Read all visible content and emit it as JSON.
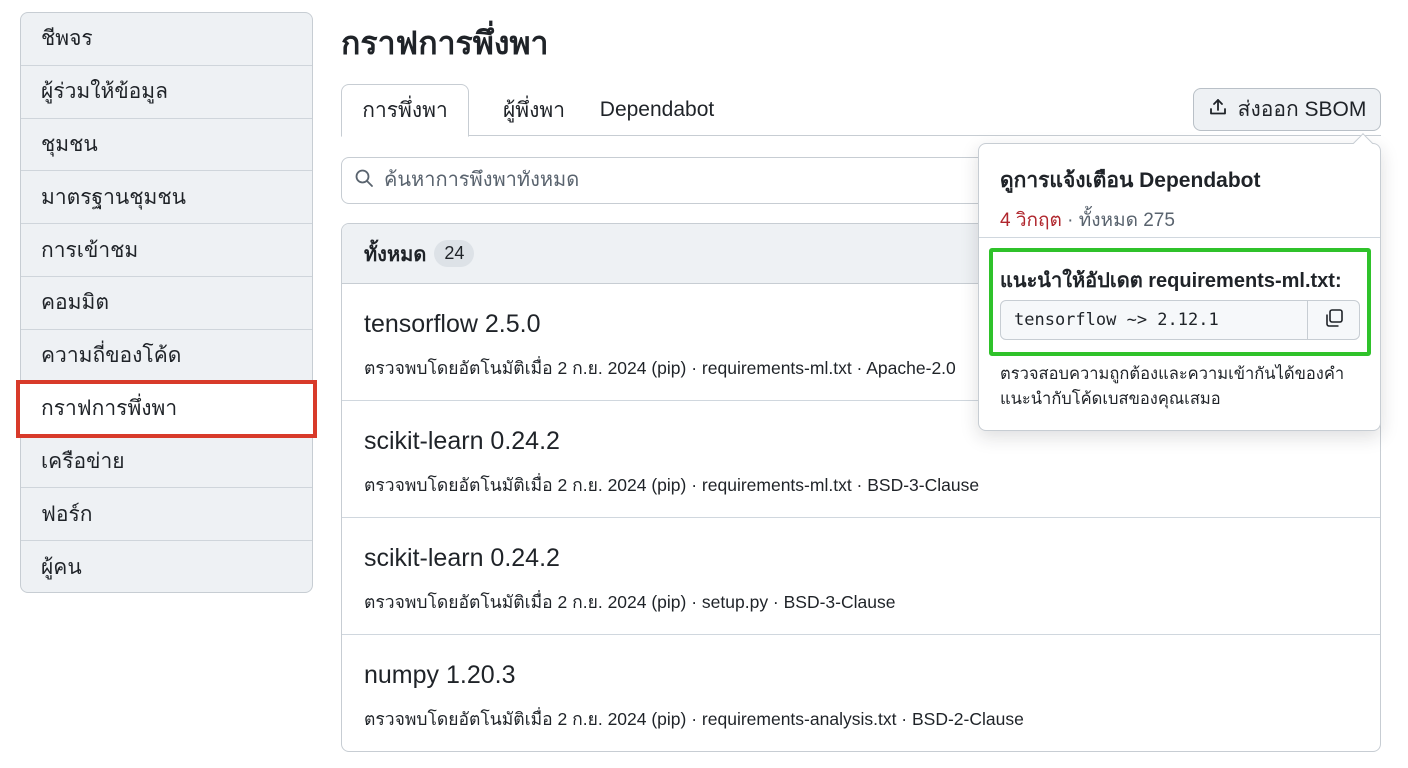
{
  "sidebar": {
    "items": [
      {
        "label": "ชีพจร"
      },
      {
        "label": "ผู้ร่วมให้ข้อมูล"
      },
      {
        "label": "ชุมชน"
      },
      {
        "label": "มาตรฐานชุมชน"
      },
      {
        "label": "การเข้าชม"
      },
      {
        "label": "คอมมิต"
      },
      {
        "label": "ความถี่ของโค้ด"
      },
      {
        "label": "กราฟการพึ่งพา",
        "active": true
      },
      {
        "label": "เครือข่าย"
      },
      {
        "label": "ฟอร์ก"
      },
      {
        "label": "ผู้คน"
      }
    ]
  },
  "header": {
    "title": "กราฟการพึ่งพา"
  },
  "tabs": [
    {
      "label": "การพึ่งพา",
      "active": true
    },
    {
      "label": "ผู้พึ่งพา"
    },
    {
      "label": "Dependabot"
    }
  ],
  "export_button": {
    "label": "ส่งออก SBOM",
    "icon": "upload-icon"
  },
  "search": {
    "placeholder": "ค้นหาการพึ่งพาทั้งหมด",
    "icon": "search-icon"
  },
  "list": {
    "header_label": "ทั้งหมด",
    "count": "24",
    "items": [
      {
        "name": "tensorflow 2.5.0",
        "meta": "ตรวจพบโดยอัตโนมัติเมื่อ 2 ก.ย. 2024 (pip) · requirements-ml.txt · Apache-2.0"
      },
      {
        "name": "scikit-learn 0.24.2",
        "meta": "ตรวจพบโดยอัตโนมัติเมื่อ 2 ก.ย. 2024 (pip) · requirements-ml.txt · BSD-3-Clause"
      },
      {
        "name": "scikit-learn 0.24.2",
        "meta": "ตรวจพบโดยอัตโนมัติเมื่อ 2 ก.ย. 2024 (pip) · setup.py · BSD-3-Clause"
      },
      {
        "name": "numpy 1.20.3",
        "meta": "ตรวจพบโดยอัตโนมัติเมื่อ 2 ก.ย. 2024 (pip) · requirements-analysis.txt · BSD-2-Clause"
      }
    ]
  },
  "popover": {
    "title": "ดูการแจ้งเตือน Dependabot",
    "critical": "4 วิกฤต",
    "total": " · ทั้งหมด 275",
    "recommend_label": "แนะนำให้อัปเดต requirements-ml.txt:",
    "code": "tensorflow ~> 2.12.1",
    "copy_icon": "copy-icon",
    "note": "ตรวจสอบความถูกต้องและความเข้ากันได้ของคำแนะนำกับโค้ดเบสของคุณเสมอ"
  },
  "colors": {
    "active_outline": "#d83a2a",
    "highlight": "#2fc22a",
    "critical": "#b0262d"
  }
}
